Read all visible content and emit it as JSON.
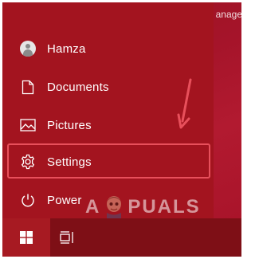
{
  "background_window_text": "anage",
  "start_menu": {
    "items": [
      {
        "label": "Hamza",
        "icon": "user-avatar-icon"
      },
      {
        "label": "Documents",
        "icon": "document-icon"
      },
      {
        "label": "Pictures",
        "icon": "pictures-icon"
      },
      {
        "label": "Settings",
        "icon": "gear-icon",
        "highlighted": true
      },
      {
        "label": "Power",
        "icon": "power-icon"
      }
    ]
  },
  "taskbar": {
    "buttons": [
      "windows-logo-icon",
      "task-view-icon"
    ]
  },
  "watermark": {
    "left": "A",
    "right": "PUALS"
  },
  "colors": {
    "accent": "#a3141f",
    "taskbar": "#7e0f16",
    "highlight_box": "#e8505b",
    "arrow": "#e8505b"
  }
}
